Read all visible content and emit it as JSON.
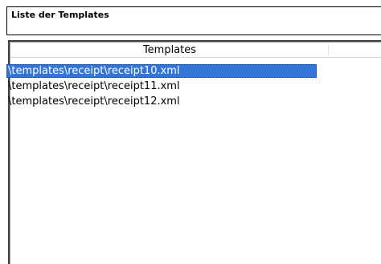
{
  "panel": {
    "title": "Liste der Templates"
  },
  "list": {
    "column_header": "Templates",
    "items": [
      {
        "label": "\\templates\\receipt\\receipt10.xml",
        "selected": true
      },
      {
        "label": "\\templates\\receipt\\receipt11.xml",
        "selected": false
      },
      {
        "label": "\\templates\\receipt\\receipt12.xml",
        "selected": false
      }
    ]
  },
  "colors": {
    "selection": "#3375d6",
    "selection_text": "#ffffff"
  }
}
